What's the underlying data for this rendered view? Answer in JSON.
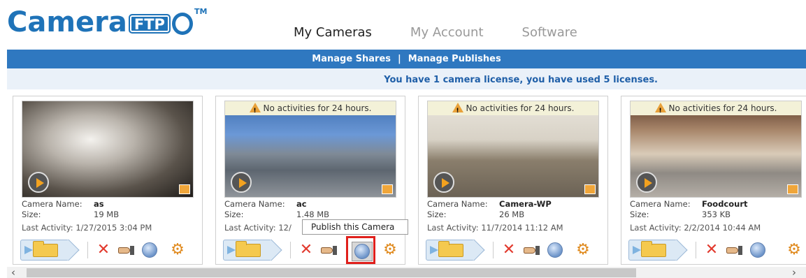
{
  "brand": {
    "name_part": "Camera",
    "box_part": "FTP",
    "tm": "TM"
  },
  "nav": {
    "items": [
      {
        "label": "My Cameras",
        "active": true
      },
      {
        "label": "My Account",
        "active": false
      },
      {
        "label": "Software",
        "active": false
      }
    ]
  },
  "subnav": {
    "manage_shares": "Manage Shares",
    "separator": "|",
    "manage_publishes": "Manage Publishes"
  },
  "license_message": "You have 1 camera license, you have used 5 licenses.",
  "labels": {
    "camera_name": "Camera Name:",
    "size": "Size:",
    "last_activity": "Last Activity:"
  },
  "cameras": [
    {
      "warning": "",
      "name": "as",
      "size": "19 MB",
      "last_activity": "1/27/2015 3:04 PM"
    },
    {
      "warning": "No activities for 24 hours.",
      "name": "ac",
      "size": "1.48 MB",
      "last_activity": "12/"
    },
    {
      "warning": "No activities for 24 hours.",
      "name": "Camera-WP",
      "size": "26 MB",
      "last_activity": "11/7/2014 11:12 AM"
    },
    {
      "warning": "No activities for 24 hours.",
      "name": "Foodcourt",
      "size": "353 KB",
      "last_activity": "2/2/2014 10:44 AM"
    }
  ],
  "tooltip": "Publish this Camera",
  "colors": {
    "brand_blue": "#1f73b8",
    "bar_blue": "#2f78c0",
    "highlight_red": "#e0201c"
  }
}
